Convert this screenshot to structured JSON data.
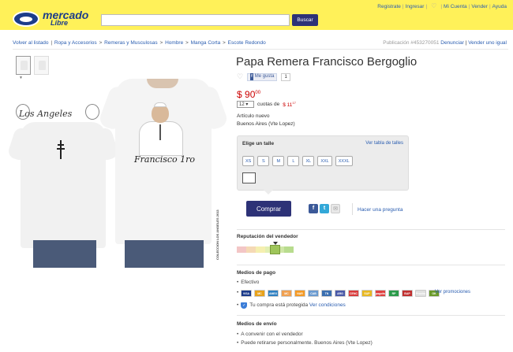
{
  "header": {
    "logo_line1": "mercado",
    "logo_line2": "Libre",
    "search_placeholder": "",
    "search_button": "Buscar",
    "links": [
      "Registrate",
      "Ingresar",
      "Mi Cuenta",
      "Vender",
      "Ayuda"
    ]
  },
  "breadcrumb": {
    "back": "Volver al listado",
    "items": [
      "Ropa y Accesorios",
      "Remeras y Musculosas",
      "Hombre",
      "Manga Corta",
      "Escote Redondo"
    ],
    "publication": "Publicación #453270051",
    "report": "Denunciar",
    "sell_same": "Vender uno igual"
  },
  "product": {
    "title": "Papa Remera Francisco Bergoglio",
    "fb_like": "Me gusta",
    "fb_count": "1",
    "price_symbol": "$",
    "price_int": "90",
    "price_dec": "00",
    "installments_value": "12",
    "installments_text": "cuotas de",
    "installment_price": "$ 11",
    "installment_dec": "17",
    "condition": "Artículo nuevo",
    "location": "Buenos Aires (Vte Lopez)",
    "image_text_left": "Los Angeles",
    "image_text_right": "Francisco 1ro",
    "image_vertical_text": "COLECCION LOS ANGELES 2013"
  },
  "size_selector": {
    "title": "Elige un talle",
    "table_link": "Ver tabla de talles",
    "sizes": [
      "XS",
      "S",
      "M",
      "L",
      "XL",
      "XXL",
      "XXXL"
    ]
  },
  "actions": {
    "buy": "Comprar",
    "ask": "Hacer una pregunta"
  },
  "seller": {
    "reputation_title": "Reputación del vendedor",
    "reputation_colors": [
      "#f3c6c6",
      "#f5d9b5",
      "#f5efb0",
      "#e2efb3",
      "#cfe6a6",
      "#b8dc8e"
    ],
    "reputation_level": 0.7
  },
  "payment": {
    "title": "Medios de pago",
    "cash": "Efectivo",
    "methods": [
      {
        "name": "VISA",
        "color": "#1a3a8a"
      },
      {
        "name": "MC",
        "color": "#e8a21a"
      },
      {
        "name": "AMEX",
        "color": "#2d7fc1"
      },
      {
        "name": "MC",
        "color": "#f0a050"
      },
      {
        "name": "NAR",
        "color": "#f59a24"
      },
      {
        "name": "CAB",
        "color": "#6a9ad0"
      },
      {
        "name": "TN",
        "color": "#3b6fb0"
      },
      {
        "name": "ARG",
        "color": "#4a5aa8"
      },
      {
        "name": "CENC",
        "color": "#d83a3a"
      },
      {
        "name": "SUP",
        "color": "#e8b820"
      },
      {
        "name": "pagofacil",
        "color": "#e04040"
      },
      {
        "name": "RP",
        "color": "#2a9a4a"
      },
      {
        "name": "BAP",
        "color": "#c03030"
      },
      {
        "name": "Provincia",
        "color": "#e0e0e0"
      },
      {
        "name": "OK",
        "color": "#6a9a2a"
      }
    ],
    "promo_link": "Ver promociones",
    "protected_text": "Tu compra está protegida",
    "conditions_link": "Ver condiciones"
  },
  "shipping": {
    "title": "Medios de envío",
    "options": [
      "A convenir con el vendedor",
      "Puede retirarse personalmente. Buenos Aires (Vte Lopez)"
    ]
  }
}
